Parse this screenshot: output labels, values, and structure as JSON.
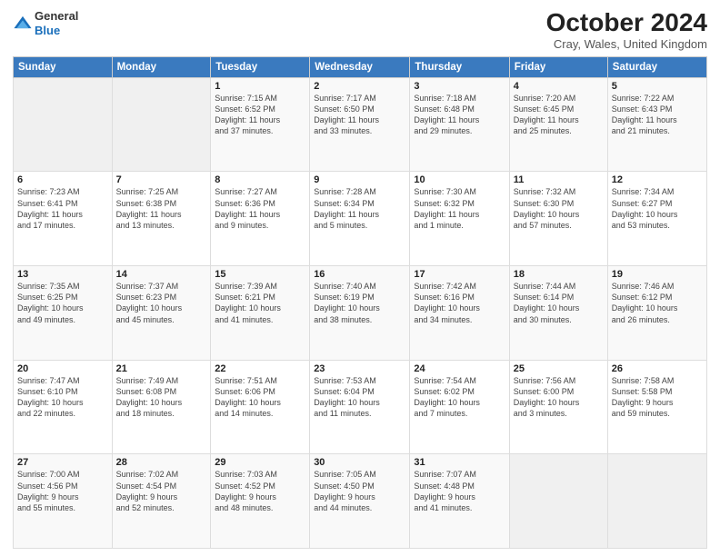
{
  "logo": {
    "line1": "General",
    "line2": "Blue"
  },
  "title": "October 2024",
  "subtitle": "Cray, Wales, United Kingdom",
  "days_of_week": [
    "Sunday",
    "Monday",
    "Tuesday",
    "Wednesday",
    "Thursday",
    "Friday",
    "Saturday"
  ],
  "weeks": [
    [
      {
        "day": "",
        "content": ""
      },
      {
        "day": "",
        "content": ""
      },
      {
        "day": "1",
        "content": "Sunrise: 7:15 AM\nSunset: 6:52 PM\nDaylight: 11 hours\nand 37 minutes."
      },
      {
        "day": "2",
        "content": "Sunrise: 7:17 AM\nSunset: 6:50 PM\nDaylight: 11 hours\nand 33 minutes."
      },
      {
        "day": "3",
        "content": "Sunrise: 7:18 AM\nSunset: 6:48 PM\nDaylight: 11 hours\nand 29 minutes."
      },
      {
        "day": "4",
        "content": "Sunrise: 7:20 AM\nSunset: 6:45 PM\nDaylight: 11 hours\nand 25 minutes."
      },
      {
        "day": "5",
        "content": "Sunrise: 7:22 AM\nSunset: 6:43 PM\nDaylight: 11 hours\nand 21 minutes."
      }
    ],
    [
      {
        "day": "6",
        "content": "Sunrise: 7:23 AM\nSunset: 6:41 PM\nDaylight: 11 hours\nand 17 minutes."
      },
      {
        "day": "7",
        "content": "Sunrise: 7:25 AM\nSunset: 6:38 PM\nDaylight: 11 hours\nand 13 minutes."
      },
      {
        "day": "8",
        "content": "Sunrise: 7:27 AM\nSunset: 6:36 PM\nDaylight: 11 hours\nand 9 minutes."
      },
      {
        "day": "9",
        "content": "Sunrise: 7:28 AM\nSunset: 6:34 PM\nDaylight: 11 hours\nand 5 minutes."
      },
      {
        "day": "10",
        "content": "Sunrise: 7:30 AM\nSunset: 6:32 PM\nDaylight: 11 hours\nand 1 minute."
      },
      {
        "day": "11",
        "content": "Sunrise: 7:32 AM\nSunset: 6:30 PM\nDaylight: 10 hours\nand 57 minutes."
      },
      {
        "day": "12",
        "content": "Sunrise: 7:34 AM\nSunset: 6:27 PM\nDaylight: 10 hours\nand 53 minutes."
      }
    ],
    [
      {
        "day": "13",
        "content": "Sunrise: 7:35 AM\nSunset: 6:25 PM\nDaylight: 10 hours\nand 49 minutes."
      },
      {
        "day": "14",
        "content": "Sunrise: 7:37 AM\nSunset: 6:23 PM\nDaylight: 10 hours\nand 45 minutes."
      },
      {
        "day": "15",
        "content": "Sunrise: 7:39 AM\nSunset: 6:21 PM\nDaylight: 10 hours\nand 41 minutes."
      },
      {
        "day": "16",
        "content": "Sunrise: 7:40 AM\nSunset: 6:19 PM\nDaylight: 10 hours\nand 38 minutes."
      },
      {
        "day": "17",
        "content": "Sunrise: 7:42 AM\nSunset: 6:16 PM\nDaylight: 10 hours\nand 34 minutes."
      },
      {
        "day": "18",
        "content": "Sunrise: 7:44 AM\nSunset: 6:14 PM\nDaylight: 10 hours\nand 30 minutes."
      },
      {
        "day": "19",
        "content": "Sunrise: 7:46 AM\nSunset: 6:12 PM\nDaylight: 10 hours\nand 26 minutes."
      }
    ],
    [
      {
        "day": "20",
        "content": "Sunrise: 7:47 AM\nSunset: 6:10 PM\nDaylight: 10 hours\nand 22 minutes."
      },
      {
        "day": "21",
        "content": "Sunrise: 7:49 AM\nSunset: 6:08 PM\nDaylight: 10 hours\nand 18 minutes."
      },
      {
        "day": "22",
        "content": "Sunrise: 7:51 AM\nSunset: 6:06 PM\nDaylight: 10 hours\nand 14 minutes."
      },
      {
        "day": "23",
        "content": "Sunrise: 7:53 AM\nSunset: 6:04 PM\nDaylight: 10 hours\nand 11 minutes."
      },
      {
        "day": "24",
        "content": "Sunrise: 7:54 AM\nSunset: 6:02 PM\nDaylight: 10 hours\nand 7 minutes."
      },
      {
        "day": "25",
        "content": "Sunrise: 7:56 AM\nSunset: 6:00 PM\nDaylight: 10 hours\nand 3 minutes."
      },
      {
        "day": "26",
        "content": "Sunrise: 7:58 AM\nSunset: 5:58 PM\nDaylight: 9 hours\nand 59 minutes."
      }
    ],
    [
      {
        "day": "27",
        "content": "Sunrise: 7:00 AM\nSunset: 4:56 PM\nDaylight: 9 hours\nand 55 minutes."
      },
      {
        "day": "28",
        "content": "Sunrise: 7:02 AM\nSunset: 4:54 PM\nDaylight: 9 hours\nand 52 minutes."
      },
      {
        "day": "29",
        "content": "Sunrise: 7:03 AM\nSunset: 4:52 PM\nDaylight: 9 hours\nand 48 minutes."
      },
      {
        "day": "30",
        "content": "Sunrise: 7:05 AM\nSunset: 4:50 PM\nDaylight: 9 hours\nand 44 minutes."
      },
      {
        "day": "31",
        "content": "Sunrise: 7:07 AM\nSunset: 4:48 PM\nDaylight: 9 hours\nand 41 minutes."
      },
      {
        "day": "",
        "content": ""
      },
      {
        "day": "",
        "content": ""
      }
    ]
  ]
}
